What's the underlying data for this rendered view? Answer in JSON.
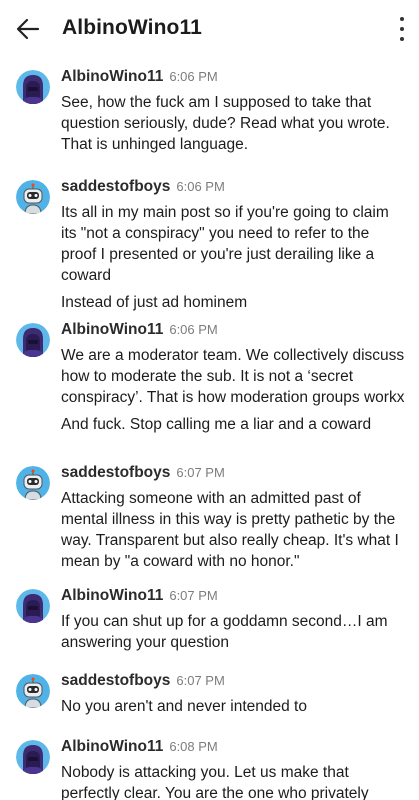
{
  "header": {
    "title": "AlbinoWino11"
  },
  "messages": [
    {
      "author": "AlbinoWino11",
      "time": "6:06 PM",
      "avatar": "purple-hooded-snoo-avatar",
      "paragraphs": [
        "See, how the fuck am I supposed to take that question seriously, dude?  Read what you wrote.  That is unhinged language."
      ]
    },
    {
      "author": "saddestofboys",
      "time": "6:06 PM",
      "avatar": "robot-snoo-avatar",
      "paragraphs": [
        "Its all in my main post so if you're going to claim its \"not a conspiracy\" you need to refer to the proof I presented or you're just derailing like a coward",
        "Instead of just ad hominem"
      ]
    },
    {
      "author": "AlbinoWino11",
      "time": "6:06 PM",
      "avatar": "purple-hooded-snoo-avatar",
      "paragraphs": [
        "We are a moderator team.  We collectively discuss how to moderate the sub.  It is not a ‘secret conspiracy’.  That is how moderation groups workx",
        "And fuck.  Stop calling me a liar and a coward"
      ]
    },
    {
      "author": "saddestofboys",
      "time": "6:07 PM",
      "avatar": "robot-snoo-avatar",
      "paragraphs": [
        "Attacking someone with an admitted past of mental illness in this way is pretty pathetic by the way. Transparent but also really cheap. It's what I mean by \"a coward with no honor.\""
      ]
    },
    {
      "author": "AlbinoWino11",
      "time": "6:07 PM",
      "avatar": "purple-hooded-snoo-avatar",
      "paragraphs": [
        "If you can shut up for a goddamn second…I am answering your question"
      ]
    },
    {
      "author": "saddestofboys",
      "time": "6:07 PM",
      "avatar": "robot-snoo-avatar",
      "paragraphs": [
        "No you aren't and never intended to"
      ]
    },
    {
      "author": "AlbinoWino11",
      "time": "6:08 PM",
      "avatar": "purple-hooded-snoo-avatar",
      "paragraphs": [
        "Nobody is attacking you.  Let us make that perfectly clear.  You are the one who privately"
      ]
    }
  ],
  "icons": {
    "back": "arrow-left-icon",
    "menu": "more-vertical-icon"
  }
}
